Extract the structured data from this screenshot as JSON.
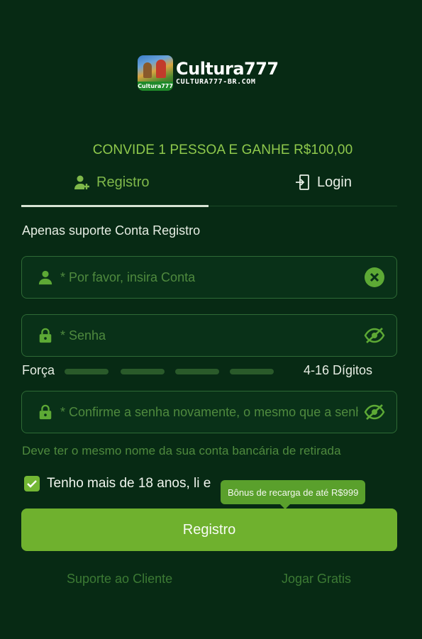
{
  "brand": {
    "title": "Cultura777",
    "subtitle": "CULTURA777-BR.COM",
    "badge": "Cultura777"
  },
  "promo": "CONVIDE 1 PESSOA E GANHE R$100,00",
  "tabs": [
    {
      "label": "Registro",
      "icon": "add-user-icon",
      "active": true
    },
    {
      "label": "Login",
      "icon": "login-icon",
      "active": false
    }
  ],
  "info_text": "Apenas suporte Conta Registro",
  "fields": {
    "account": {
      "placeholder": "* Por favor, insira Conta",
      "value": "",
      "icon": "user-icon",
      "action_icon": "clear-icon"
    },
    "password": {
      "placeholder": "* Senha",
      "value": "",
      "icon": "lock-icon",
      "action_icon": "eye-off-icon"
    },
    "confirm": {
      "placeholder": "* Confirme a senha novamente, o mesmo que a senha",
      "value": "",
      "icon": "lock-icon",
      "action_icon": "eye-off-icon"
    }
  },
  "strength": {
    "label": "Força",
    "levels": 4,
    "filled": 0,
    "digits": "4-16 Dígitos"
  },
  "hint": "Deve ter o mesmo nome da sua conta bancária de retirada",
  "terms": {
    "checked": true,
    "text": "Tenho mais de 18 anos, li e"
  },
  "tooltip": "Bônus de recarga de até R$999",
  "submit_label": "Registro",
  "footer": {
    "support": "Suporte ao Cliente",
    "play_free": "Jogar Gratis"
  },
  "colors": {
    "background": "#072a14",
    "accent": "#6fb12e",
    "promo_text": "#8fc94c",
    "field_border": "#2e6a35"
  }
}
